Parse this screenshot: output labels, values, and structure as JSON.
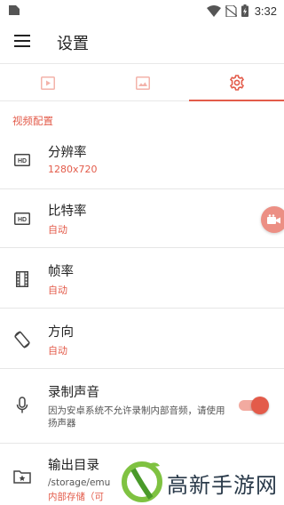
{
  "status_bar": {
    "time": "3:32",
    "icons": [
      "sim-icon",
      "wifi-icon",
      "no-sim-icon",
      "battery-charging-icon"
    ]
  },
  "app_bar": {
    "menu_icon": "hamburger-menu-icon",
    "title": "设置"
  },
  "tabs": [
    {
      "id": "video",
      "icon": "video-icon",
      "active": false
    },
    {
      "id": "image",
      "icon": "image-icon",
      "active": false
    },
    {
      "id": "settings",
      "icon": "gear-icon",
      "active": true
    }
  ],
  "section": {
    "header": "视频配置"
  },
  "settings": {
    "resolution": {
      "icon": "hd-icon",
      "title": "分辨率",
      "value": "1280x720"
    },
    "bitrate": {
      "icon": "hd-icon",
      "title": "比特率",
      "value": "自动"
    },
    "framerate": {
      "icon": "film-icon",
      "title": "帧率",
      "value": "自动"
    },
    "orientation": {
      "icon": "rotate-screen-icon",
      "title": "方向",
      "value": "自动"
    },
    "audio": {
      "icon": "microphone-icon",
      "title": "录制声音",
      "description": "因为安卓系统不允许录制内部音频，请使用扬声器",
      "enabled": true
    },
    "output": {
      "icon": "folder-star-icon",
      "title": "输出目录",
      "path": "/storage/emu",
      "storage": "内部存储（可"
    }
  },
  "fab": {
    "icon": "camera-record-icon"
  },
  "watermark": {
    "text": "高新手游网"
  },
  "colors": {
    "accent": "#e35b4a",
    "accent_light": "#ec8f84",
    "tab_inactive": "#f3b3aa",
    "divider": "#e6e6e6"
  }
}
